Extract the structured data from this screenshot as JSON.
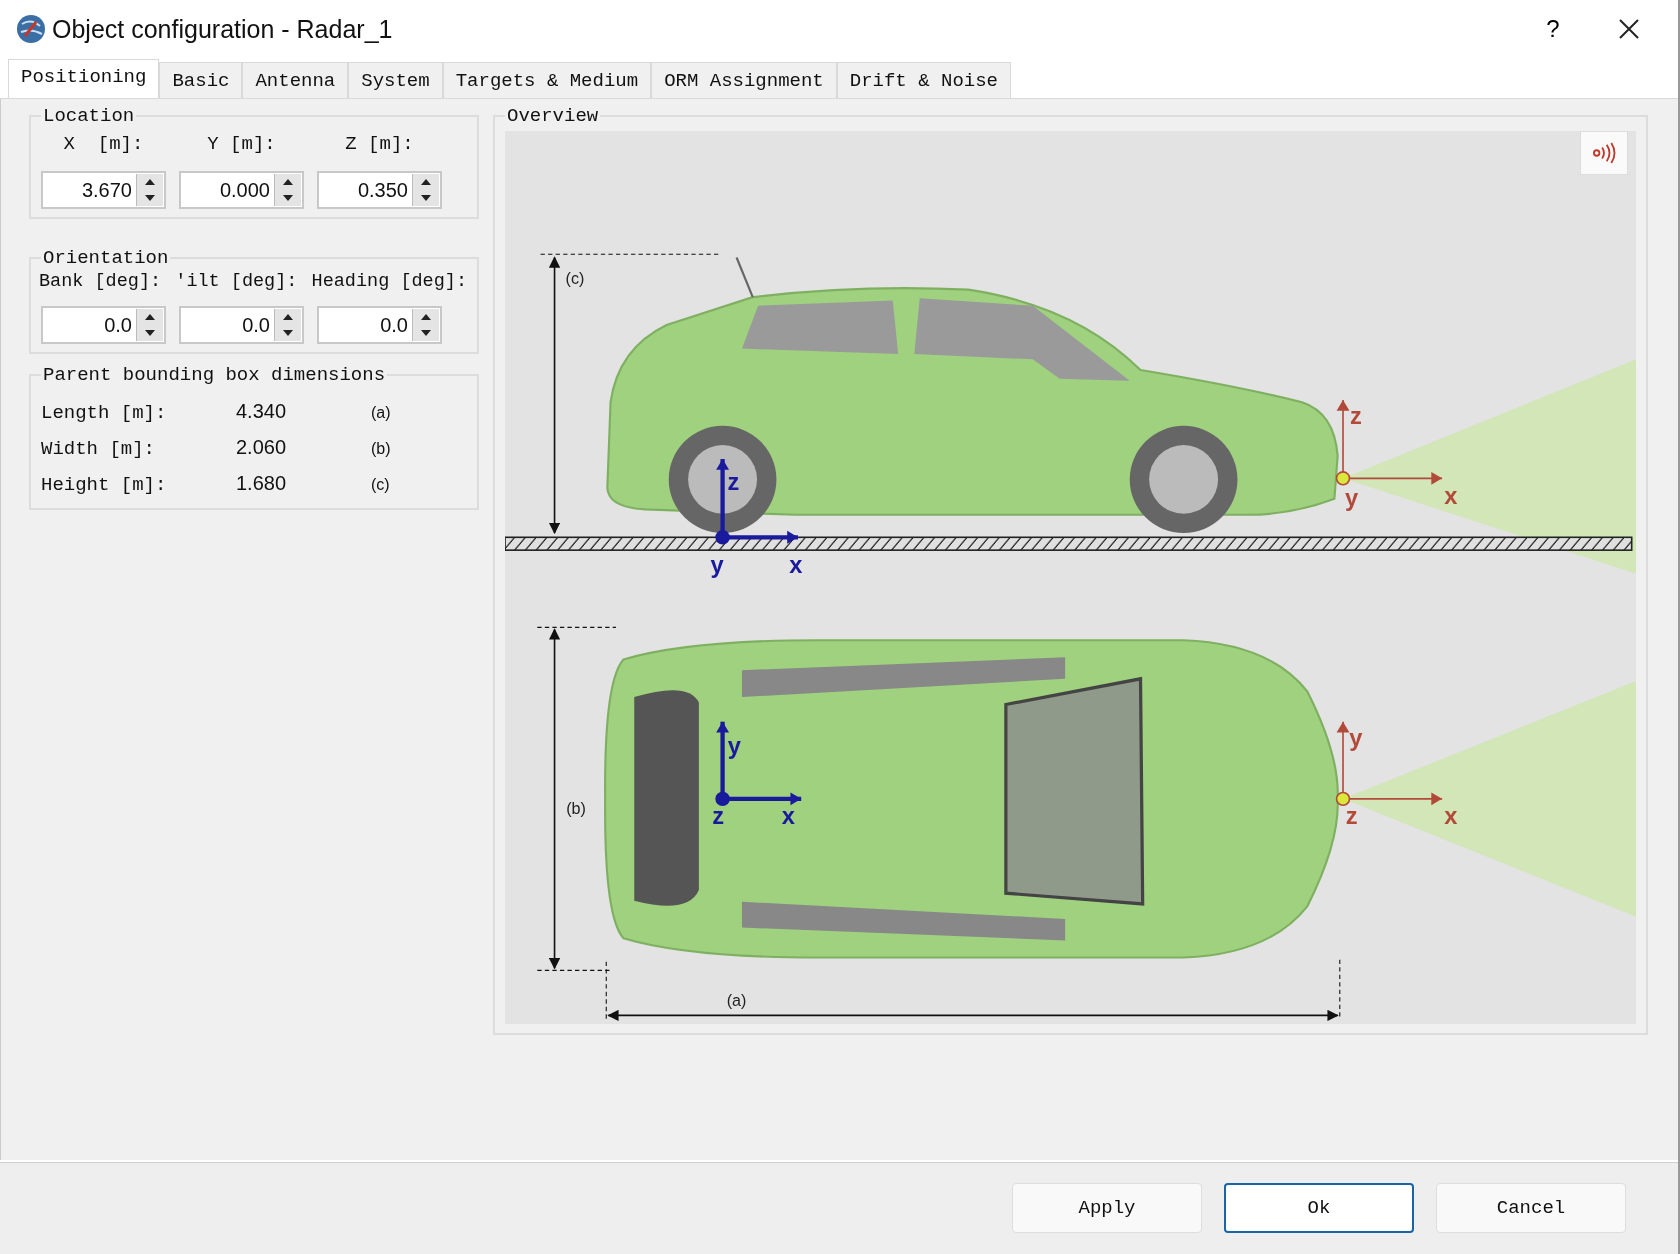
{
  "window": {
    "title": "Object configuration - Radar_1",
    "help": "?"
  },
  "tabs": [
    {
      "label": "Positioning",
      "selected": true
    },
    {
      "label": "Basic",
      "selected": false
    },
    {
      "label": "Antenna",
      "selected": false
    },
    {
      "label": "System",
      "selected": false
    },
    {
      "label": "Targets & Medium",
      "selected": false
    },
    {
      "label": "ORM Assignment",
      "selected": false
    },
    {
      "label": "Drift & Noise",
      "selected": false
    }
  ],
  "location": {
    "title": "Location",
    "fields": [
      {
        "label": "X  [m]:",
        "value": "3.670"
      },
      {
        "label": "Y [m]:",
        "value": "0.000"
      },
      {
        "label": "Z [m]:",
        "value": "0.350"
      }
    ]
  },
  "orientation": {
    "title": "Orientation",
    "fields": [
      {
        "label": "Bank [deg]:",
        "value": "0.0"
      },
      {
        "label": "'ilt [deg]:",
        "value": "0.0"
      },
      {
        "label": "Heading [deg]:",
        "value": "0.0"
      }
    ]
  },
  "dimensions": {
    "title": "Parent bounding box dimensions",
    "rows": [
      {
        "label": "Length [m]:",
        "value": "4.340",
        "tag": "(a)"
      },
      {
        "label": "Width [m]:",
        "value": "2.060",
        "tag": "(b)"
      },
      {
        "label": "Height [m]:",
        "value": "1.680",
        "tag": "(c)"
      }
    ]
  },
  "overview": {
    "title": "Overview",
    "dimension_labels": [
      "(c)",
      "(b)",
      "(a)"
    ],
    "axes": [
      {
        "labels": [
          "z",
          "x",
          "y"
        ]
      },
      {
        "labels": [
          "z",
          "x",
          "y"
        ]
      },
      {
        "labels": [
          "y",
          "x",
          "z"
        ]
      },
      {
        "labels": [
          "y",
          "x",
          "z"
        ]
      }
    ]
  },
  "buttons": [
    {
      "label": "Apply",
      "default": false
    },
    {
      "label": "Ok",
      "default": true
    },
    {
      "label": "Cancel",
      "default": false
    }
  ]
}
